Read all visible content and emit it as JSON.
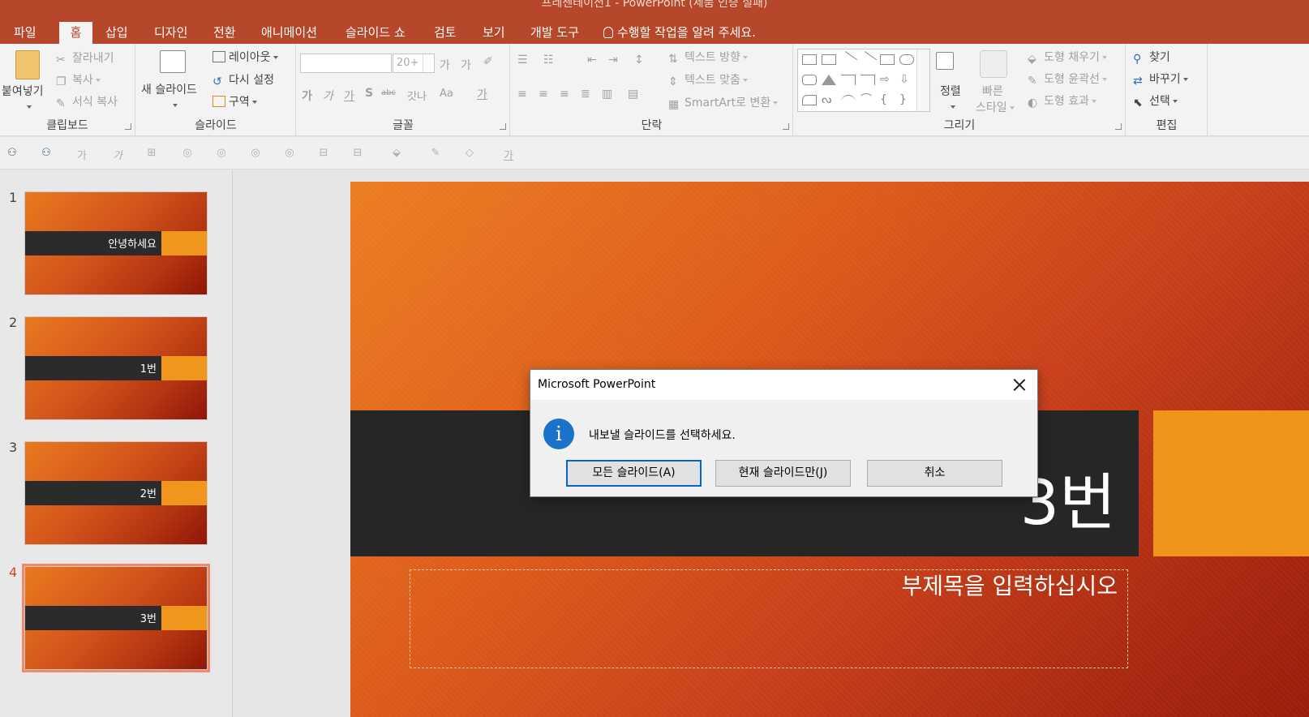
{
  "window": {
    "title": "프레젠테이션1 - PowerPoint (제품 인증 실패)"
  },
  "tabs": [
    "파일",
    "홈",
    "삽입",
    "디자인",
    "전환",
    "애니메이션",
    "슬라이드 쇼",
    "검토",
    "보기",
    "개발 도구"
  ],
  "active_tab": "홈",
  "tell_me": "수행할 작업을 알려 주세요.",
  "ribbon": {
    "clipboard": {
      "paste": "붙여넣기",
      "cut": "잘라내기",
      "copy": "복사",
      "format_painter": "서식 복사",
      "label": "클립보드"
    },
    "slides": {
      "new_slide": "새 슬라이드",
      "layout": "레이아웃",
      "reset": "다시 설정",
      "section": "구역",
      "label": "슬라이드"
    },
    "font": {
      "font_name": "",
      "font_size": "20+",
      "grow": "가",
      "shrink": "가",
      "bold": "가",
      "italic": "가",
      "underline": "가",
      "shadow": "S",
      "strike": "abc",
      "spacing": "갓나",
      "case": "Aa",
      "color": "가",
      "label": "글꼴"
    },
    "paragraph": {
      "text_direction": "텍스트 방향",
      "align_text": "텍스트 맞춤",
      "smartart": "SmartArt로 변환",
      "label": "단락"
    },
    "drawing": {
      "arrange": "정렬",
      "quick_styles_1": "빠른",
      "quick_styles_2": "스타일",
      "fill": "도형 채우기",
      "outline": "도형 윤곽선",
      "effects": "도형 효과",
      "label": "그리기"
    },
    "editing": {
      "find": "찾기",
      "replace": "바꾸기",
      "select": "선택",
      "label": "편집"
    }
  },
  "quick_toolbar": {
    "bold": "가",
    "italic": "가",
    "color": "가"
  },
  "slides": [
    {
      "number": "1",
      "title": "안녕하세요"
    },
    {
      "number": "2",
      "title": "1번"
    },
    {
      "number": "3",
      "title": "2번"
    },
    {
      "number": "4",
      "title": "3번"
    }
  ],
  "selected_slide": "4",
  "current_slide": {
    "title": "3번",
    "subtitle_placeholder": "부제목을 입력하십시오"
  },
  "dialog": {
    "title": "Microsoft PowerPoint",
    "message": "내보낼 슬라이드를 선택하세요.",
    "buttons": {
      "all": "모든 슬라이드(A)",
      "current": "현재 슬라이드만(J)",
      "cancel": "취소"
    }
  },
  "colors": {
    "accent": "#b7472a",
    "slide_band": "#262626",
    "slide_accent": "#f0941a",
    "info_icon": "#1a73c9"
  }
}
